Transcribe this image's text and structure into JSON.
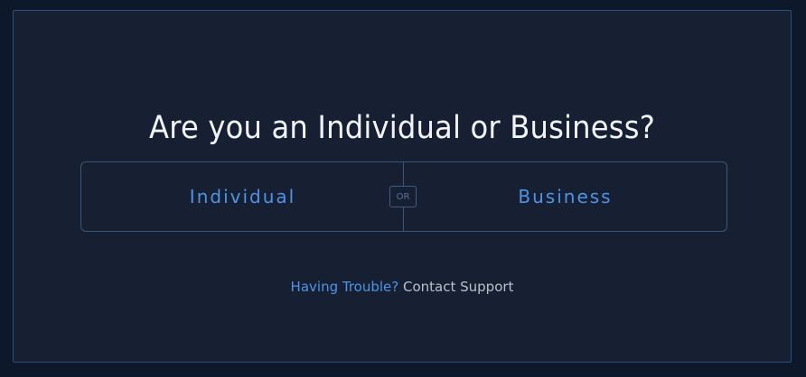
{
  "heading": "Are you an Individual or Business?",
  "choices": {
    "individual_label": "Individual",
    "or_label": "OR",
    "business_label": "Business"
  },
  "support": {
    "trouble_label": "Having Trouble?",
    "contact_label": "Contact Support"
  },
  "colors": {
    "background": "#0d182a",
    "panel": "#172033",
    "accent": "#4e93e6",
    "border": "#3c5677"
  }
}
